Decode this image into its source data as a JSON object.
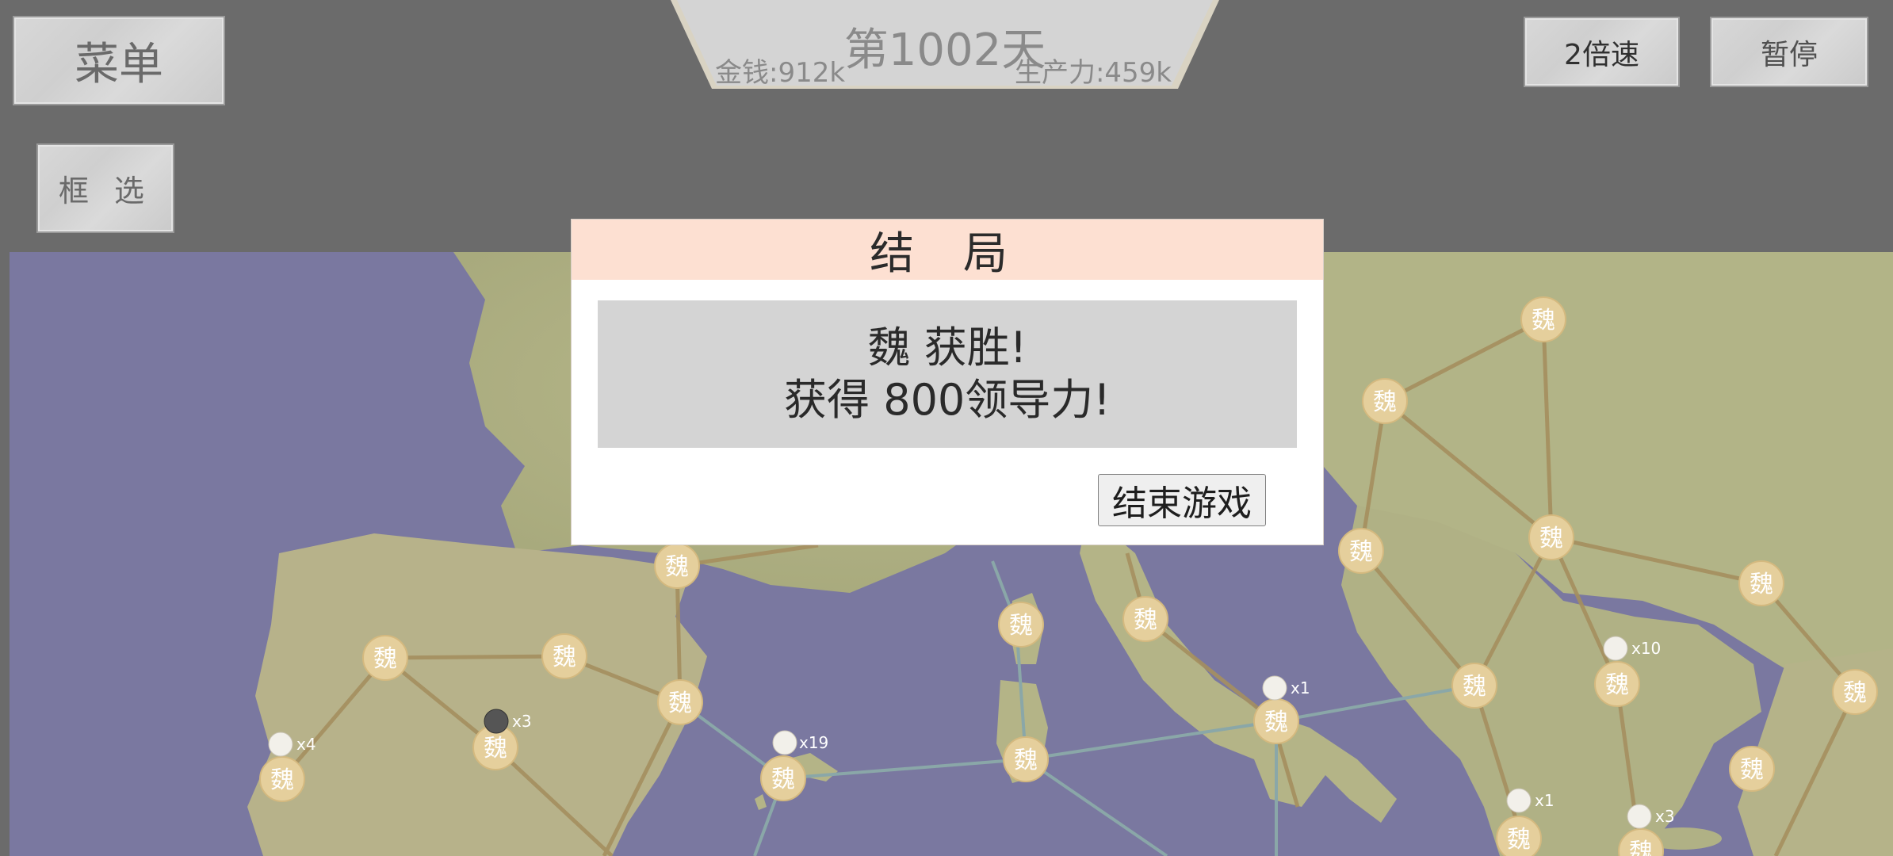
{
  "hud": {
    "menu_label": "菜单",
    "select_label": "框 选",
    "speed_label": "2倍速",
    "pause_label": "暂停",
    "day_label": "第1002天",
    "money_label": "金钱:912k",
    "production_label": "生产力:459k"
  },
  "dialog": {
    "title": "结 局",
    "message_line1": "魏 获胜!",
    "message_line2": "获得 800领导力!",
    "end_button_label": "结束游戏"
  },
  "map": {
    "faction_char": "魏",
    "colors": {
      "sea": "#7a78a0",
      "land": "#b4b58a",
      "city": "#e5cf9c",
      "road": "#a58f5f",
      "sea_route": "#8aa7a8"
    },
    "army_counts": [
      "x4",
      "x3",
      "x19",
      "x1",
      "x10",
      "x1",
      "x3"
    ]
  }
}
